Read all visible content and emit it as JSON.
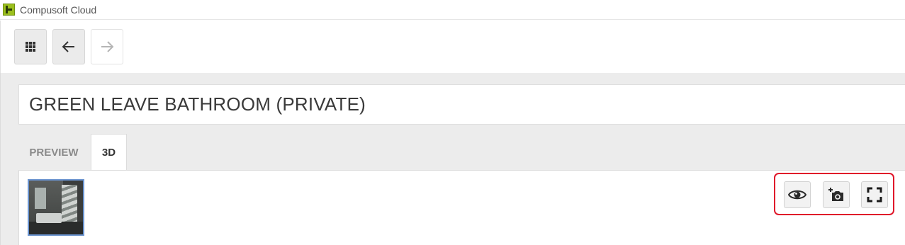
{
  "app": {
    "title": "Compusoft Cloud",
    "logo": "compusoft-logo"
  },
  "toolbar": {
    "buttons": [
      {
        "name": "apps",
        "icon": "grid-icon",
        "enabled": true
      },
      {
        "name": "back",
        "icon": "arrow-left-icon",
        "enabled": true
      },
      {
        "name": "forward",
        "icon": "arrow-right-icon",
        "enabled": false
      }
    ]
  },
  "project": {
    "title": "GREEN LEAVE BATHROOM (PRIVATE)"
  },
  "tabs": [
    {
      "label": "PREVIEW",
      "active": false
    },
    {
      "label": "3D",
      "active": true
    }
  ],
  "viewer": {
    "thumbnail": "bathroom-render-thumbnail",
    "actions": [
      {
        "name": "view",
        "icon": "eye-icon"
      },
      {
        "name": "snapshot",
        "icon": "camera-plus-icon"
      },
      {
        "name": "fullscreen",
        "icon": "fullscreen-icon"
      }
    ]
  },
  "colors": {
    "highlight": "#e0172a",
    "thumbnail_border": "#6a93cf",
    "brand_green": "#9bbf1d"
  }
}
